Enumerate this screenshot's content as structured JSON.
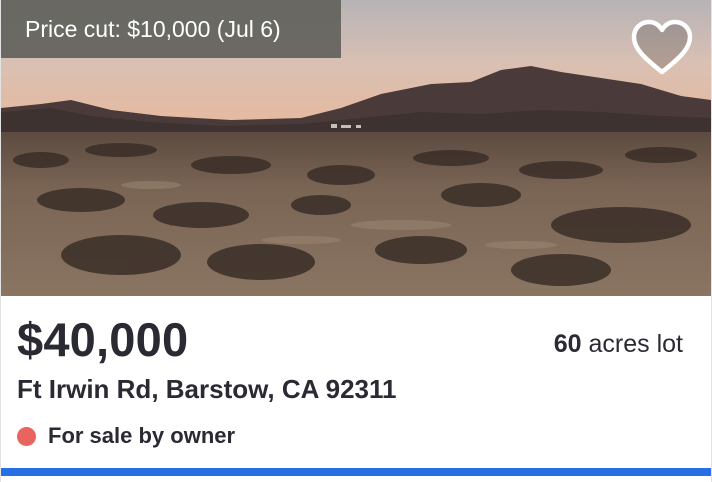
{
  "listing": {
    "price_cut_text": "Price cut: $10,000 (Jul 6)",
    "price": "$40,000",
    "lot_size_value": "60",
    "lot_size_unit": "acres lot",
    "address": "Ft Irwin Rd, Barstow, CA 92311",
    "status": "For sale by owner",
    "status_color": "#e9635f",
    "accent_color": "#2670e4",
    "favorite_icon": "heart-outline-icon",
    "favorited": false
  }
}
